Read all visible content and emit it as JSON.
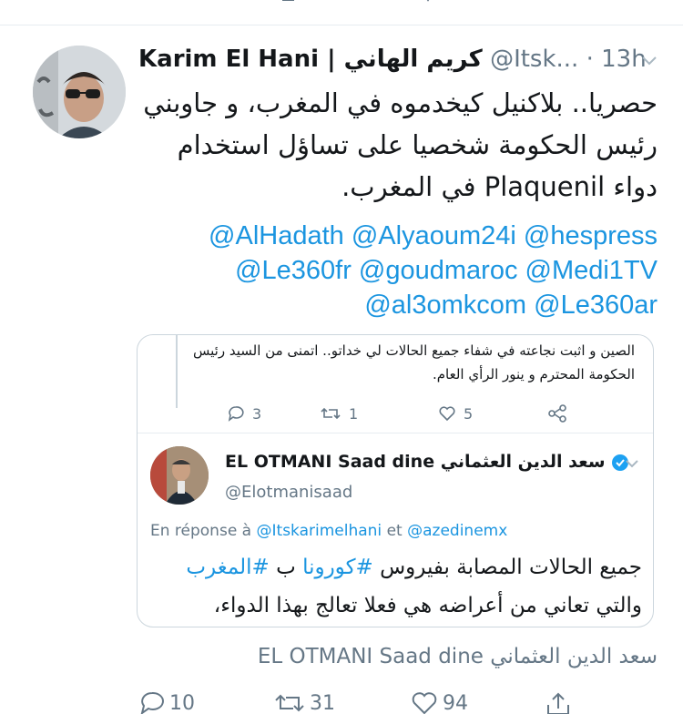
{
  "tweet": {
    "display_name": "Karim El Hani | كريم الهاني",
    "handle_time": "@Itsk... · 13h",
    "text": "حصريا.. بلاكنيل كيخدموه في المغرب، و جاوبني رئيس الحكومة شخصيا على تساؤل استخدام دواء Plaquenil في المغرب.",
    "mentions": [
      "@AlHadath",
      "@Alyaoum24i",
      "@hespress",
      "@Le360fr",
      "@goudmaroc",
      "@Medi1TV",
      "@al3omkcom",
      "@Le360ar"
    ]
  },
  "embed": {
    "previous_text": "الصين و اثبت نجاعته في شفاء جميع الحالات لي خداتو.. اتمنى من السيد رئيس الحكومة المحترم و ينور الرأي العام.",
    "previous_counts": {
      "reply": "3",
      "retweet": "1",
      "like": "5"
    },
    "quoted_name": "EL OTMANI Saad dine سعد الدين العثماني",
    "quoted_handle": "@Elotmanisaad",
    "reply_prefix": "En réponse à",
    "reply_to_1": "@Itskarimelhani",
    "reply_and": "et",
    "reply_to_2": "@azedinemx",
    "text_1": "جميع الحالات المصابة بفيروس ",
    "hashtag_1": "#كورونا",
    "text_2": " ب ",
    "hashtag_2": "#المغرب",
    "text_3": "والتي تعاني من أعراضه هي فعلا تعالج بهذا الدواء،"
  },
  "author_line": "EL OTMANI Saad dine سعد الدين العثماني",
  "actions": {
    "reply": "10",
    "retweet": "31",
    "like": "94"
  },
  "colors": {
    "link": "#1b95e0",
    "muted": "#657786",
    "text": "#14171a",
    "border": "#ccd6dd"
  }
}
